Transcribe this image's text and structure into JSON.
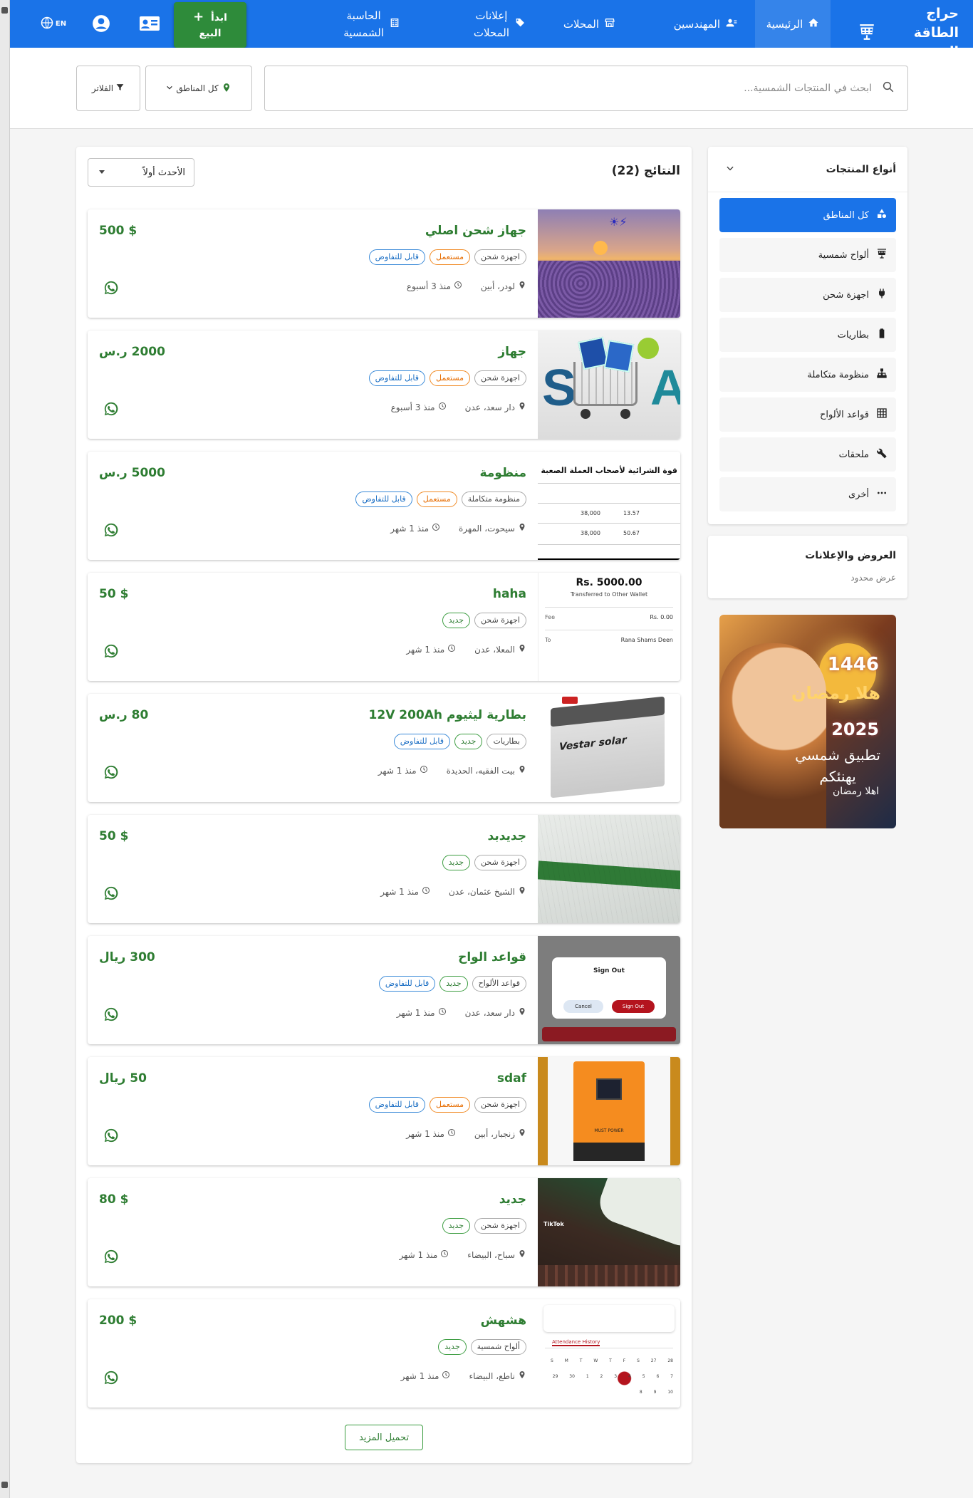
{
  "brand": {
    "name": "حراج الطاقة الشمسية"
  },
  "nav": {
    "home": "الرئيسية",
    "engineers": "المهندسين",
    "stores": "المحلات",
    "store_ads_1": "إعلانات",
    "store_ads_2": "المحلات",
    "calculator_1": "الحاسبة",
    "calculator_2": "الشمسية",
    "sell_1": "ابدأ",
    "sell_2": "البيع",
    "sell_plus": "+",
    "lang": "EN"
  },
  "search": {
    "placeholder": "ابحث في المنتجات الشمسية...",
    "areas": "كل المناطق",
    "filters": "الفلاتر"
  },
  "sidebar": {
    "title": "أنواع المنتجات",
    "items": [
      {
        "label": "كل المناطق",
        "icon": "shapes-icon"
      },
      {
        "label": "ألواح شمسية",
        "icon": "solar-panel-icon"
      },
      {
        "label": "اجهزة شحن",
        "icon": "plug-icon"
      },
      {
        "label": "بطاريات",
        "icon": "battery-icon"
      },
      {
        "label": "منظومة متكاملة",
        "icon": "network-icon"
      },
      {
        "label": "قواعد الألواح",
        "icon": "grid-icon"
      },
      {
        "label": "ملحقات",
        "icon": "wrench-icon"
      },
      {
        "label": "أخرى",
        "icon": "more-icon"
      }
    ],
    "offers_title": "العروض والإعلانات",
    "offers_sub": "عرض محدود"
  },
  "banner": {
    "year_hijri": "1446",
    "greeting": "هلا رمضان",
    "year": "2025",
    "line1": "تطبيق شمسي",
    "line2": "يهنئكم",
    "line3": "اهلا رمضان"
  },
  "results": {
    "title": "النتائج (22)",
    "sort": "الأحدث أولاً",
    "load_more": "تحميل المزيد",
    "listings": [
      {
        "title": "جهاز شحن اصلي",
        "price": "$ 500",
        "tags": [
          "اجهزة شحن",
          "مستعمل",
          "قابل للتفاوض"
        ],
        "location": "لودر، أبين",
        "time": "منذ 3 أسبوع"
      },
      {
        "title": "جهاز",
        "price": "2000 ر.س",
        "tags": [
          "اجهزة شحن",
          "مستعمل",
          "قابل للتفاوض"
        ],
        "location": "دار سعد، عدن",
        "time": "منذ 3 أسبوع"
      },
      {
        "title": "منظومة",
        "price": "5000 ر.س",
        "tags": [
          "منظومة متكاملة",
          "مستعمل",
          "قابل للتفاوض"
        ],
        "location": "سيحوت، المهرة",
        "time": "منذ 1 شهر"
      },
      {
        "title": "haha",
        "price": "$ 50",
        "tags": [
          "اجهزة شحن",
          "جديد"
        ],
        "location": "المعلا، عدن",
        "time": "منذ 1 شهر"
      },
      {
        "title": "بطارية ليثيوم 12V 200Ah",
        "price": "80 ر.س",
        "tags": [
          "بطاريات",
          "جديد",
          "قابل للتفاوض"
        ],
        "location": "بيت الفقيه، الحديدة",
        "time": "منذ 1 شهر"
      },
      {
        "title": "جديدبد",
        "price": "$ 50",
        "tags": [
          "اجهزة شحن",
          "جديد"
        ],
        "location": "الشيخ عثمان، عدن",
        "time": "منذ 1 شهر"
      },
      {
        "title": "قواعد الواح",
        "price": "300 ريال",
        "tags": [
          "قواعد الألواح",
          "جديد",
          "قابل للتفاوض"
        ],
        "location": "دار سعد، عدن",
        "time": "منذ 1 شهر"
      },
      {
        "title": "sdaf",
        "price": "50 ريال",
        "tags": [
          "اجهزة شحن",
          "مستعمل",
          "قابل للتفاوض"
        ],
        "location": "زنجبار، أبين",
        "time": "منذ 1 شهر"
      },
      {
        "title": "جديد",
        "price": "$ 80",
        "tags": [
          "اجهزة شحن",
          "جديد"
        ],
        "location": "سباح، البيضاء",
        "time": "منذ 1 شهر"
      },
      {
        "title": "هشهش",
        "price": "$ 200",
        "tags": [
          "ألواح شمسية",
          "جديد"
        ],
        "location": "ناطع، البيضاء",
        "time": "منذ 1 شهر"
      }
    ]
  },
  "thumbs": {
    "t3": "قوة الشرائية لأصحاب العملة الصعبة",
    "t4_amount": "Rs. 5000.00",
    "t4_sub": "Transferred to Other Wallet",
    "t4_fee": "Fee",
    "t4_fee_val": "Rs. 0.00",
    "t4_to": "To",
    "t4_to_val": "Rana Shams Deen",
    "t5_brand": "Vestar solar",
    "t7_title": "Sign Out",
    "t7_cancel": "Cancel",
    "t7_ok": "Sign Out",
    "t8_brand": "MUST POWER",
    "t9_brand": "TikTok",
    "t10_tab": "Attendance History"
  },
  "colors": {
    "primary": "#1a73e8",
    "green": "#2e7d32",
    "orange": "#f08a24",
    "blue_tag": "#3a8ad8"
  }
}
